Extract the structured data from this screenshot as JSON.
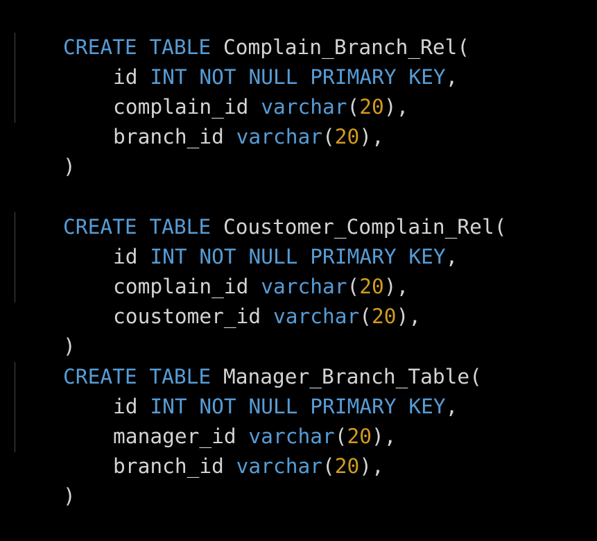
{
  "code": {
    "kw_create": "CREATE",
    "kw_table": "TABLE",
    "kw_int": "INT",
    "kw_not": "NOT",
    "kw_null": "NULL",
    "kw_primary": "PRIMARY",
    "kw_key": "KEY",
    "kw_varchar": "varchar",
    "num_20": "20",
    "blocks": [
      {
        "table_name": "Complain_Branch_Rel(",
        "col_id": "id",
        "col_2": "complain_id",
        "col_3": "branch_id",
        "close": ")"
      },
      {
        "table_name": "Coustomer_Complain_Rel(",
        "col_id": "id",
        "col_2": "complain_id",
        "col_3": "coustomer_id",
        "close": ")"
      },
      {
        "table_name": "Manager_Branch_Table(",
        "col_id": "id",
        "col_2": "manager_id",
        "col_3": "branch_id",
        "close": ")"
      }
    ]
  },
  "colors": {
    "background": "#000000",
    "keyword": "#569cd6",
    "number": "#d19a1f",
    "text": "#d4d4d4",
    "indent_guide": "#4a4a4a"
  }
}
